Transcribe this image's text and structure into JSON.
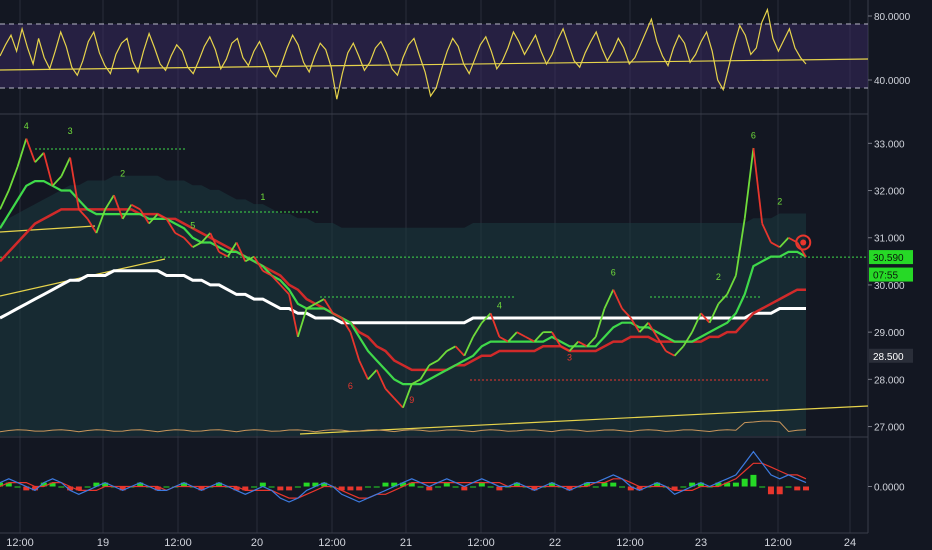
{
  "chart_data": [
    {
      "type": "line",
      "panel": "oscillator-top",
      "yticks": [
        "80.0000",
        "40.0000"
      ],
      "ylim": [
        20,
        90
      ],
      "bands": [
        75,
        35
      ],
      "colors": {
        "line": "#e6d34b",
        "band": "#3f2c6b",
        "trend": "#e6d34b"
      },
      "series": [
        {
          "values": [
            55,
            62,
            68,
            58,
            72,
            60,
            50,
            66,
            54,
            47,
            58,
            70,
            61,
            48,
            43,
            52,
            64,
            70,
            57,
            49,
            44,
            56,
            63,
            66,
            52,
            45,
            58,
            69,
            60,
            50,
            46,
            55,
            62,
            58,
            48,
            44,
            52,
            61,
            67,
            59,
            47,
            53,
            63,
            66,
            54,
            49,
            58,
            64,
            56,
            46,
            42,
            50,
            60,
            68,
            62,
            51,
            45,
            55,
            63,
            59,
            48,
            28,
            44,
            57,
            63,
            55,
            46,
            51,
            60,
            64,
            57,
            47,
            43,
            54,
            62,
            66,
            55,
            45,
            30,
            35,
            47,
            58,
            66,
            61,
            50,
            44,
            53,
            62,
            67,
            58,
            47,
            52,
            60,
            70,
            64,
            56,
            62,
            68,
            58,
            50,
            56,
            65,
            72,
            62,
            52,
            48,
            57,
            64,
            70,
            60,
            52,
            58,
            66,
            60,
            50,
            54,
            62,
            70,
            78,
            64,
            55,
            49,
            60,
            68,
            63,
            51,
            56,
            64,
            70,
            58,
            40,
            34,
            48,
            62,
            74,
            68,
            56,
            60,
            76,
            84,
            66,
            58,
            65,
            72,
            60,
            54,
            50
          ]
        }
      ]
    },
    {
      "type": "line",
      "panel": "price-main",
      "yticks": [
        "33.000",
        "32.000",
        "31.000",
        "30.000",
        "29.000",
        "28.000",
        "27.000"
      ],
      "ylim": [
        26.8,
        33.6
      ],
      "price_badges": {
        "last": "30.590",
        "timer": "07:55",
        "marker": "28.500"
      },
      "colors": {
        "price": "#6fdc3b",
        "down": "#e8362d",
        "ma_short": "#3fd94a",
        "ma_mid": "#d12a2a",
        "ma_long": "#ffffff",
        "trend": "#e6d34b",
        "cloud": "#1b3b3f",
        "td_up": "#6fdc3b",
        "td_down": "#e8362d"
      },
      "series": [
        {
          "values": [
            31.6,
            32.0,
            32.5,
            33.1,
            32.6,
            32.8,
            32.1,
            32.3,
            32.7,
            31.6,
            31.4,
            31.1,
            31.6,
            31.9,
            31.4,
            31.7,
            31.6,
            31.3,
            31.5,
            31.4,
            31.1,
            31.0,
            30.8,
            30.9,
            31.1,
            30.7,
            30.6,
            30.9,
            30.5,
            30.6,
            30.3,
            30.2,
            30.0,
            29.8,
            28.9,
            29.5,
            29.6,
            29.7,
            29.4,
            29.3,
            29.0,
            28.4,
            28.0,
            28.2,
            27.8,
            27.6,
            27.4,
            27.9,
            28.0,
            28.3,
            28.4,
            28.6,
            28.7,
            28.5,
            28.9,
            29.2,
            29.4,
            28.9,
            28.8,
            29.0,
            28.9,
            28.8,
            29.0,
            29.0,
            28.7,
            28.6,
            28.8,
            28.7,
            28.9,
            29.5,
            29.9,
            29.5,
            29.3,
            29.0,
            29.2,
            28.9,
            28.6,
            28.5,
            28.7,
            29.0,
            29.4,
            29.2,
            29.6,
            29.8,
            30.2,
            31.4,
            32.9,
            31.3,
            30.9,
            30.8,
            31.0,
            30.9,
            30.59
          ]
        },
        {
          "values": [
            31.2,
            31.5,
            31.8,
            32.1,
            32.2,
            32.2,
            32.1,
            32.0,
            32.0,
            31.8,
            31.6,
            31.5,
            31.5,
            31.5,
            31.5,
            31.5,
            31.5,
            31.4,
            31.4,
            31.4,
            31.3,
            31.2,
            31.0,
            30.9,
            30.9,
            30.8,
            30.7,
            30.7,
            30.6,
            30.5,
            30.4,
            30.2,
            30.1,
            29.9,
            29.6,
            29.5,
            29.5,
            29.5,
            29.4,
            29.3,
            29.2,
            28.9,
            28.6,
            28.4,
            28.2,
            28.0,
            27.9,
            27.9,
            27.9,
            28.0,
            28.1,
            28.2,
            28.3,
            28.4,
            28.5,
            28.7,
            28.8,
            28.8,
            28.8,
            28.8,
            28.8,
            28.8,
            28.8,
            28.9,
            28.8,
            28.7,
            28.7,
            28.7,
            28.7,
            28.9,
            29.1,
            29.2,
            29.2,
            29.1,
            29.1,
            29.0,
            28.9,
            28.8,
            28.8,
            28.8,
            28.9,
            29.0,
            29.1,
            29.2,
            29.4,
            29.8,
            30.4,
            30.5,
            30.6,
            30.6,
            30.7,
            30.7,
            30.6
          ]
        },
        {
          "values": [
            30.5,
            30.7,
            30.9,
            31.1,
            31.3,
            31.4,
            31.5,
            31.6,
            31.6,
            31.6,
            31.6,
            31.6,
            31.6,
            31.6,
            31.6,
            31.6,
            31.5,
            31.5,
            31.5,
            31.4,
            31.4,
            31.3,
            31.2,
            31.1,
            31.0,
            30.9,
            30.8,
            30.7,
            30.6,
            30.5,
            30.4,
            30.3,
            30.2,
            30.0,
            29.9,
            29.7,
            29.6,
            29.5,
            29.4,
            29.3,
            29.2,
            29.0,
            28.9,
            28.7,
            28.6,
            28.4,
            28.3,
            28.2,
            28.2,
            28.2,
            28.2,
            28.2,
            28.3,
            28.3,
            28.4,
            28.5,
            28.5,
            28.6,
            28.6,
            28.6,
            28.6,
            28.6,
            28.7,
            28.7,
            28.7,
            28.6,
            28.6,
            28.6,
            28.6,
            28.7,
            28.8,
            28.8,
            28.9,
            28.9,
            28.9,
            28.8,
            28.8,
            28.8,
            28.8,
            28.8,
            28.8,
            28.9,
            28.9,
            29.0,
            29.0,
            29.2,
            29.4,
            29.5,
            29.6,
            29.7,
            29.8,
            29.9,
            29.9
          ]
        },
        {
          "values": [
            29.3,
            29.4,
            29.5,
            29.6,
            29.7,
            29.8,
            29.9,
            30.0,
            30.1,
            30.1,
            30.2,
            30.2,
            30.2,
            30.3,
            30.3,
            30.3,
            30.3,
            30.3,
            30.3,
            30.2,
            30.2,
            30.2,
            30.1,
            30.1,
            30.0,
            30.0,
            29.9,
            29.8,
            29.8,
            29.7,
            29.7,
            29.6,
            29.5,
            29.5,
            29.4,
            29.4,
            29.3,
            29.3,
            29.3,
            29.2,
            29.2,
            29.2,
            29.2,
            29.2,
            29.2,
            29.2,
            29.2,
            29.2,
            29.2,
            29.2,
            29.2,
            29.2,
            29.2,
            29.2,
            29.3,
            29.3,
            29.3,
            29.3,
            29.3,
            29.3,
            29.3,
            29.3,
            29.3,
            29.3,
            29.3,
            29.3,
            29.3,
            29.3,
            29.3,
            29.3,
            29.3,
            29.3,
            29.3,
            29.3,
            29.3,
            29.3,
            29.3,
            29.3,
            29.3,
            29.3,
            29.3,
            29.3,
            29.3,
            29.3,
            29.3,
            29.3,
            29.4,
            29.4,
            29.4,
            29.5,
            29.5,
            29.5,
            29.5
          ]
        }
      ],
      "td_counts": [
        {
          "label": "4",
          "i": 3,
          "price": 33.3,
          "dir": "up"
        },
        {
          "label": "3",
          "i": 8,
          "price": 33.2,
          "dir": "up"
        },
        {
          "label": "2",
          "i": 14,
          "price": 32.3,
          "dir": "up"
        },
        {
          "label": "5",
          "i": 22,
          "price": 31.2,
          "dir": "up"
        },
        {
          "label": "1",
          "i": 30,
          "price": 31.8,
          "dir": "up"
        },
        {
          "label": "6",
          "i": 40,
          "price": 27.8,
          "dir": "down"
        },
        {
          "label": "9",
          "i": 47,
          "price": 27.5,
          "dir": "down"
        },
        {
          "label": "4",
          "i": 57,
          "price": 29.5,
          "dir": "up"
        },
        {
          "label": "3",
          "i": 65,
          "price": 28.4,
          "dir": "down"
        },
        {
          "label": "6",
          "i": 70,
          "price": 30.2,
          "dir": "up"
        },
        {
          "label": "2",
          "i": 82,
          "price": 30.1,
          "dir": "up"
        },
        {
          "label": "6",
          "i": 86,
          "price": 33.1,
          "dir": "up"
        },
        {
          "label": "2",
          "i": 89,
          "price": 31.7,
          "dir": "up"
        }
      ]
    },
    {
      "type": "line",
      "panel": "macd-bottom",
      "yticks": [
        "0.0000"
      ],
      "ylim": [
        -1.2,
        1.2
      ],
      "colors": {
        "macd": "#3d7be0",
        "signal": "#e8362d",
        "hist_up": "#26d926",
        "hist_down": "#e8362d"
      },
      "series": [
        {
          "values": [
            0.1,
            0.2,
            0.1,
            0.0,
            -0.1,
            0.1,
            0.2,
            0.1,
            -0.1,
            -0.2,
            -0.1,
            0.0,
            0.1,
            0.0,
            -0.1,
            0.0,
            0.1,
            0.0,
            -0.1,
            -0.1,
            0.0,
            0.1,
            0.0,
            -0.1,
            0.0,
            0.1,
            0.0,
            -0.1,
            -0.2,
            -0.1,
            0.0,
            -0.1,
            -0.3,
            -0.4,
            -0.3,
            -0.1,
            0.0,
            0.1,
            0.0,
            -0.2,
            -0.3,
            -0.4,
            -0.3,
            -0.2,
            -0.1,
            0.0,
            0.1,
            0.2,
            0.1,
            0.0,
            0.1,
            0.2,
            0.1,
            0.0,
            0.1,
            0.2,
            0.1,
            0.0,
            0.0,
            0.1,
            0.0,
            -0.1,
            0.0,
            0.1,
            0.0,
            -0.1,
            0.0,
            0.1,
            0.1,
            0.2,
            0.3,
            0.2,
            0.0,
            -0.1,
            0.0,
            0.1,
            0.0,
            -0.2,
            -0.1,
            0.0,
            0.1,
            0.0,
            0.1,
            0.2,
            0.3,
            0.6,
            0.9,
            0.6,
            0.3,
            0.2,
            0.3,
            0.2,
            0.1
          ]
        },
        {
          "values": [
            0.0,
            0.1,
            0.1,
            0.1,
            0.0,
            0.0,
            0.1,
            0.1,
            0.0,
            -0.1,
            -0.1,
            -0.1,
            0.0,
            0.0,
            0.0,
            0.0,
            0.0,
            0.0,
            0.0,
            -0.1,
            0.0,
            0.0,
            0.0,
            0.0,
            0.0,
            0.0,
            0.0,
            0.0,
            -0.1,
            -0.1,
            -0.1,
            -0.1,
            -0.2,
            -0.3,
            -0.3,
            -0.2,
            -0.1,
            0.0,
            0.0,
            -0.1,
            -0.2,
            -0.3,
            -0.3,
            -0.2,
            -0.2,
            -0.1,
            0.0,
            0.1,
            0.1,
            0.1,
            0.1,
            0.1,
            0.1,
            0.1,
            0.1,
            0.1,
            0.1,
            0.1,
            0.0,
            0.0,
            0.0,
            0.0,
            0.0,
            0.0,
            0.0,
            0.0,
            0.0,
            0.0,
            0.1,
            0.1,
            0.2,
            0.2,
            0.1,
            0.0,
            0.0,
            0.0,
            0.0,
            -0.1,
            -0.1,
            -0.1,
            0.0,
            0.0,
            0.0,
            0.1,
            0.2,
            0.4,
            0.6,
            0.6,
            0.5,
            0.4,
            0.3,
            0.3,
            0.2
          ]
        }
      ]
    }
  ],
  "xaxis": {
    "labels": [
      "12:00",
      "19",
      "12:00",
      "20",
      "12:00",
      "21",
      "12:00",
      "22",
      "12:00",
      "23",
      "12:00",
      "24"
    ]
  }
}
